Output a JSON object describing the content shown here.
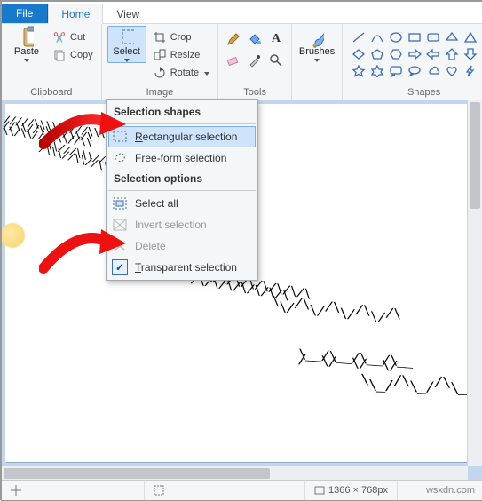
{
  "tabs": {
    "file": "File",
    "home": "Home",
    "view": "View"
  },
  "clipboard": {
    "paste": "Paste",
    "cut": "Cut",
    "copy": "Copy",
    "group": "Clipboard"
  },
  "image": {
    "select": "Select",
    "crop": "Crop",
    "resize": "Resize",
    "rotate": "Rotate",
    "group": "Image"
  },
  "tools": {
    "group": "Tools"
  },
  "brushes": {
    "label": "Brushes"
  },
  "shapes": {
    "group": "Shapes"
  },
  "dropdown": {
    "head_shapes": "Selection shapes",
    "rect": "Rectangular selection",
    "free": "Free-form selection",
    "head_opts": "Selection options",
    "all": "Select all",
    "invert": "Invert selection",
    "delete": "Delete",
    "transparent": "Transparent selection"
  },
  "status": {
    "dimensions": "1366 × 768px",
    "watermark": "wsxdn.com"
  }
}
